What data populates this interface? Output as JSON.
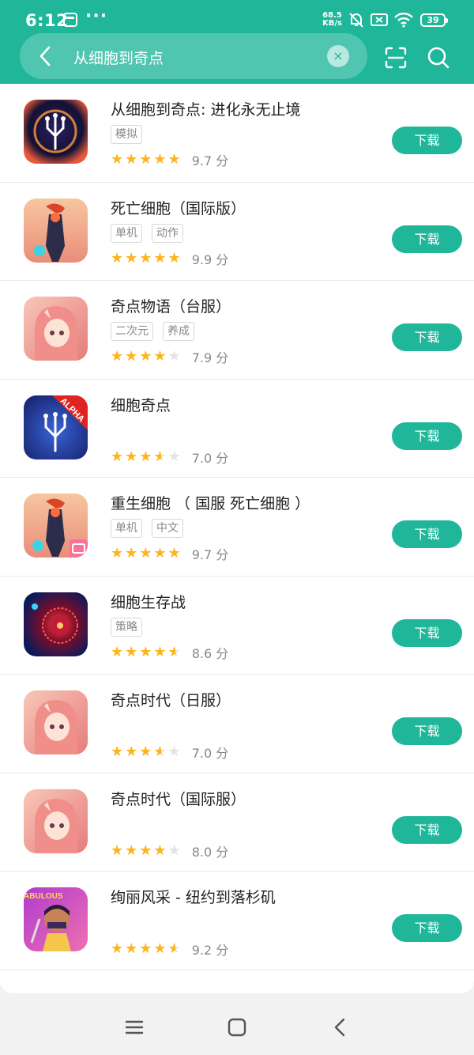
{
  "status_bar": {
    "time": "6:12",
    "dots": "···",
    "net_speed_value": "68.5",
    "net_speed_unit": "KB/s",
    "battery": "39"
  },
  "search": {
    "query": "从细胞到奇点",
    "clear_glyph": "×"
  },
  "download_label": "下载",
  "score_unit": "分",
  "apps": [
    {
      "title": "从细胞到奇点: 进化永无止境",
      "tags": [
        "模拟"
      ],
      "rating": 5,
      "score": "9.7",
      "icon": "cell-to-singularity-icon"
    },
    {
      "title": "死亡细胞（国际版）",
      "tags": [
        "单机",
        "动作"
      ],
      "rating": 5,
      "score": "9.9",
      "icon": "dead-cells-icon"
    },
    {
      "title": "奇点物语（台服）",
      "tags": [
        "二次元",
        "养成"
      ],
      "rating": 4,
      "score": "7.9",
      "icon": "anime-girl-icon"
    },
    {
      "title": "细胞奇点",
      "tags": [],
      "rating": 3.5,
      "score": "7.0",
      "icon": "cell-singularity-alpha-icon",
      "badge": "ALPHA"
    },
    {
      "title": "重生细胞 （ 国服  死亡细胞 ）",
      "tags": [
        "单机",
        "中文"
      ],
      "rating": 5,
      "score": "9.7",
      "icon": "dead-cells-cn-icon"
    },
    {
      "title": "细胞生存战",
      "tags": [
        "策略"
      ],
      "rating": 4.5,
      "score": "8.6",
      "icon": "cell-survival-icon"
    },
    {
      "title": "奇点时代（日服）",
      "tags": [],
      "rating": 3.5,
      "score": "7.0",
      "icon": "anime-girl-icon"
    },
    {
      "title": "奇点时代（国际服）",
      "tags": [],
      "rating": 4,
      "score": "8.0",
      "icon": "anime-girl-icon"
    },
    {
      "title": "绚丽风采 - 纽约到落杉矶",
      "tags": [],
      "rating": 4.5,
      "score": "9.2",
      "icon": "fabulous-icon",
      "badge": "FABULOUS"
    }
  ],
  "colors": {
    "accent": "#1fb69a",
    "star": "#fdb51b",
    "star_empty": "#e3e3e3"
  }
}
